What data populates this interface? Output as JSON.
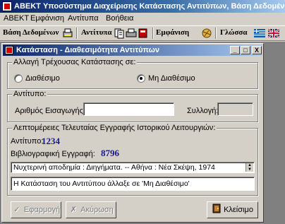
{
  "app": {
    "title": "ABEKT Υποσύστημα Διαχείρισης Κατάστασης Αντιτύπων, Βάση Δεδομένων: Mai"
  },
  "menu": {
    "items": [
      "ABEKT",
      "Εμφάνιση",
      "Αντίτυπα",
      "Βοήθεια"
    ]
  },
  "toolbar": {
    "database_label": "Βάση Δεδομένων",
    "copies_label": "Αντίτυπα",
    "display_label": "Εμφάνιση",
    "language_label": "Γλώσσα",
    "icons": [
      "printer-db-icon",
      "copy-icon",
      "printer-icon",
      "book-icon",
      "globe-icon",
      "greek-flag-icon",
      "uk-flag-icon"
    ]
  },
  "child_window": {
    "title": "Κατάσταση - Διαθεσιμότητα Αντιτύπων",
    "controls": [
      "_",
      "□",
      "X"
    ],
    "status_group": {
      "label": "Αλλαγή Τρέχουσας Κατάστασης σε:",
      "options": [
        {
          "label": "Διαθέσιμο",
          "selected": false
        },
        {
          "label": "Μη Διαθέσιμο",
          "selected": true
        }
      ]
    },
    "copy_group": {
      "label": "Αντίτυπο:",
      "accession_label": "Αριθμός Εισαγωγής:",
      "accession_value": "",
      "collection_label": "Συλλογή:",
      "collection_value": ""
    },
    "details_group": {
      "label": "Λεπτομέρειες Τελευταίας Εγγραφής Ιστορικού Λειτουργιών:",
      "copy_label": "Αντίτυπο:",
      "copy_value": "1234",
      "record_label": "Βιβλιογραφική Εγγραφή:",
      "record_value": "8796",
      "description": "Νυχτερινή αποδημία : Διηγήματα. -- Αθήνα : Νέα Σκέψη, 1974",
      "message": "Η Κατάσταση του Αντιτύπου άλλαξε σε 'Μη Διαθέσιμο'"
    },
    "buttons": {
      "apply": "Εφαρμογή",
      "cancel": "Ακύρωση",
      "close": "Κλείσιμο"
    }
  },
  "colors": {
    "title_gradient_start": "#0a246a",
    "value_blue": "#1a1a8a",
    "face": "#d4d0c8"
  }
}
